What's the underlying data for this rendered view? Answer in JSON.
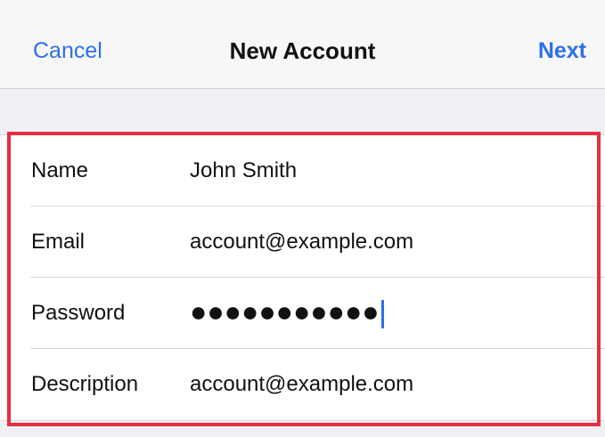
{
  "nav": {
    "cancel_label": "Cancel",
    "title": "New Account",
    "next_label": "Next"
  },
  "form": {
    "fields": [
      {
        "label": "Name",
        "value": "John Smith"
      },
      {
        "label": "Email",
        "value": "account@example.com"
      },
      {
        "label": "Password",
        "value": "●●●●●●●●●●●"
      },
      {
        "label": "Description",
        "value": "account@example.com"
      }
    ]
  },
  "colors": {
    "accent": "#2d6fe8",
    "highlight": "#e4303f"
  },
  "icons": {
    "text_cursor": "text-cursor-icon"
  }
}
